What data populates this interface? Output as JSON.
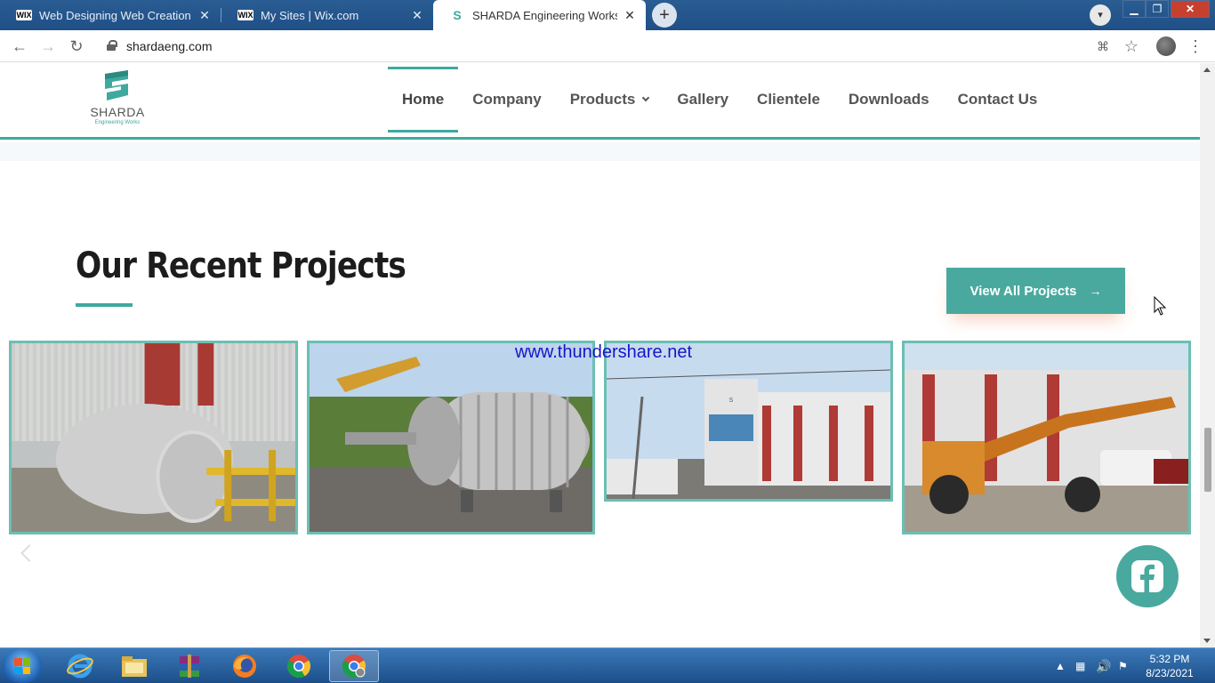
{
  "browser": {
    "tabs": [
      {
        "favicon": "WIX",
        "title": "Web Designing Web Creation W",
        "active": false
      },
      {
        "favicon": "WIX",
        "title": "My Sites | Wix.com",
        "active": false
      },
      {
        "favicon": "S",
        "title": "SHARDA Engineering Works",
        "active": true
      }
    ],
    "url": "shardaeng.com"
  },
  "site": {
    "logo": {
      "brand": "SHARDA",
      "tagline": "Engineering Works"
    },
    "nav": [
      {
        "label": "Home",
        "active": true
      },
      {
        "label": "Company"
      },
      {
        "label": "Products",
        "has_dropdown": true
      },
      {
        "label": "Gallery"
      },
      {
        "label": "Clientele"
      },
      {
        "label": "Downloads"
      },
      {
        "label": "Contact Us"
      }
    ],
    "section_title": "Our Recent Projects",
    "view_all_label": "View All Projects",
    "view_all_arrow": "→",
    "watermark": "www.thundershare.net",
    "projects": [
      {
        "image": "steel-tank-image"
      },
      {
        "image": "reactor-vessel-image"
      },
      {
        "image": "factory-building-image"
      },
      {
        "image": "crane-truck-image"
      }
    ],
    "accent_color": "#3ea99e"
  },
  "taskbar": {
    "apps": [
      "internet-explorer-icon",
      "file-explorer-icon",
      "winrar-icon",
      "firefox-icon",
      "chrome-icon",
      "chrome-icon"
    ],
    "time": "5:32 PM",
    "date": "8/23/2021"
  }
}
